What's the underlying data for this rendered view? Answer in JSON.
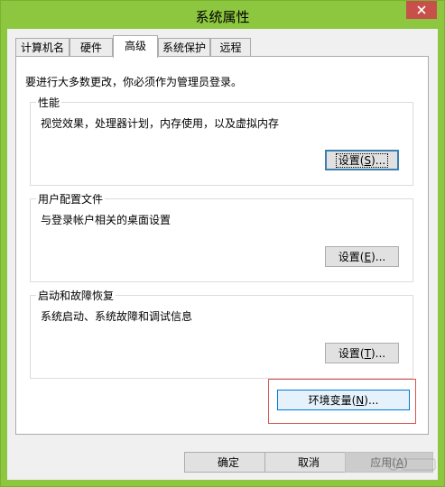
{
  "window": {
    "title": "系统属性",
    "close_icon": "close-icon"
  },
  "tabs": [
    {
      "label": "计算机名",
      "active": false
    },
    {
      "label": "硬件",
      "active": false
    },
    {
      "label": "高级",
      "active": true
    },
    {
      "label": "系统保护",
      "active": false
    },
    {
      "label": "远程",
      "active": false
    }
  ],
  "admin_note": "要进行大多数更改，你必须作为管理员登录。",
  "groups": {
    "performance": {
      "title": "性能",
      "description": "视觉效果，处理器计划，内存使用，以及虚拟内存",
      "button_text": "设置(",
      "button_key": "S",
      "button_suffix": ")..."
    },
    "user_profiles": {
      "title": "用户配置文件",
      "description": "与登录帐户相关的桌面设置",
      "button_text": "设置(",
      "button_key": "E",
      "button_suffix": ")..."
    },
    "startup_recovery": {
      "title": "启动和故障恢复",
      "description": "系统启动、系统故障和调试信息",
      "button_text": "设置(",
      "button_key": "T",
      "button_suffix": ")..."
    }
  },
  "env_button": {
    "text": "环境变量(",
    "key": "N",
    "suffix": ")..."
  },
  "bottom_buttons": {
    "ok": "确定",
    "cancel": "取消",
    "apply_text": "应用(",
    "apply_key": "A",
    "apply_suffix": ")"
  },
  "colors": {
    "window_frame": "#8dc63f",
    "close_button": "#c7504a",
    "highlight_border": "#d9534f"
  }
}
